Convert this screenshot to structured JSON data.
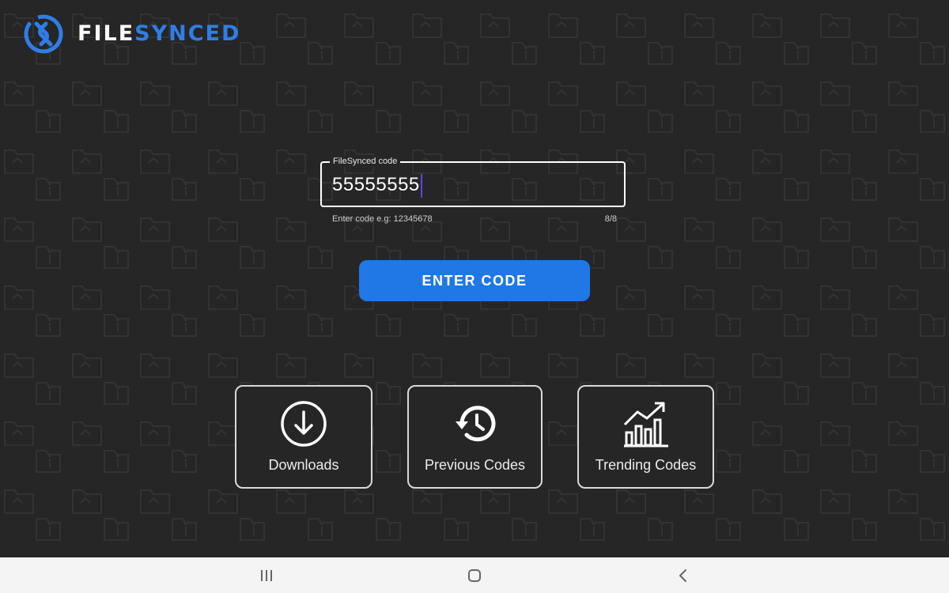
{
  "app": {
    "logo_text_part1": "FILE",
    "logo_text_part2": "SYNCED",
    "logo_icon": "filesynced-logo-icon",
    "brand_color": "#2f7ee8"
  },
  "code_field": {
    "label": "FileSynced code",
    "value": "55555555",
    "helper": "Enter code e.g: 12345678",
    "counter": "8/8"
  },
  "enter_button": {
    "label": "ENTER CODE",
    "color": "#1f78e6"
  },
  "cards": [
    {
      "label": "Downloads",
      "icon": "download-circle-icon"
    },
    {
      "label": "Previous Codes",
      "icon": "history-icon"
    },
    {
      "label": "Trending Codes",
      "icon": "trending-chart-icon"
    }
  ],
  "system_nav": {
    "recents_icon": "recents-icon",
    "home_icon": "home-icon",
    "back_icon": "back-icon"
  }
}
